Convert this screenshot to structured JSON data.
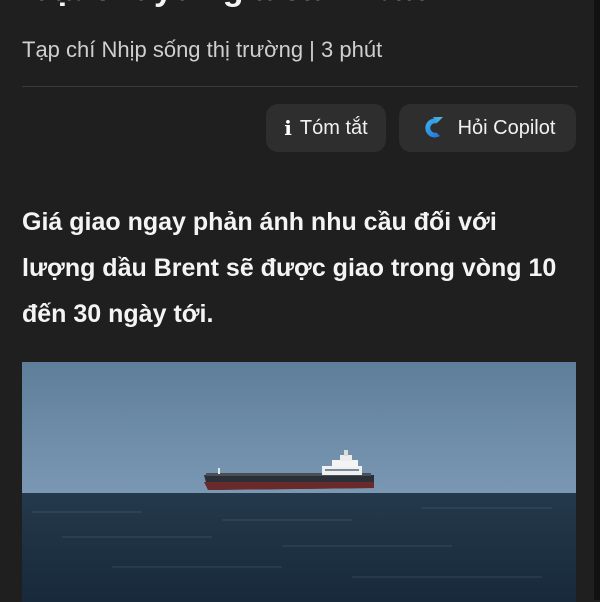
{
  "article": {
    "title_partial": "loạt chuyên gia cảnh báo",
    "byline": "Tạp chí Nhịp sống thị trường | 3 phút",
    "lead": "Giá giao ngay phản ánh nhu cầu đối với lượng dầu Brent sẽ được giao trong vòng 10 đến 30 ngày tới."
  },
  "actions": {
    "summary_label": "Tóm tắt",
    "summary_icon": "info-icon",
    "copilot_label": "Hỏi Copilot",
    "copilot_icon": "copilot-icon"
  },
  "photo": {
    "subject": "oil-tanker-on-sea"
  },
  "colors": {
    "background": "#1f1f1f",
    "button_bg": "#2e2e2e",
    "text": "#f2f2f2",
    "sky": "#6b8aa6",
    "sea": "#1d3447"
  }
}
